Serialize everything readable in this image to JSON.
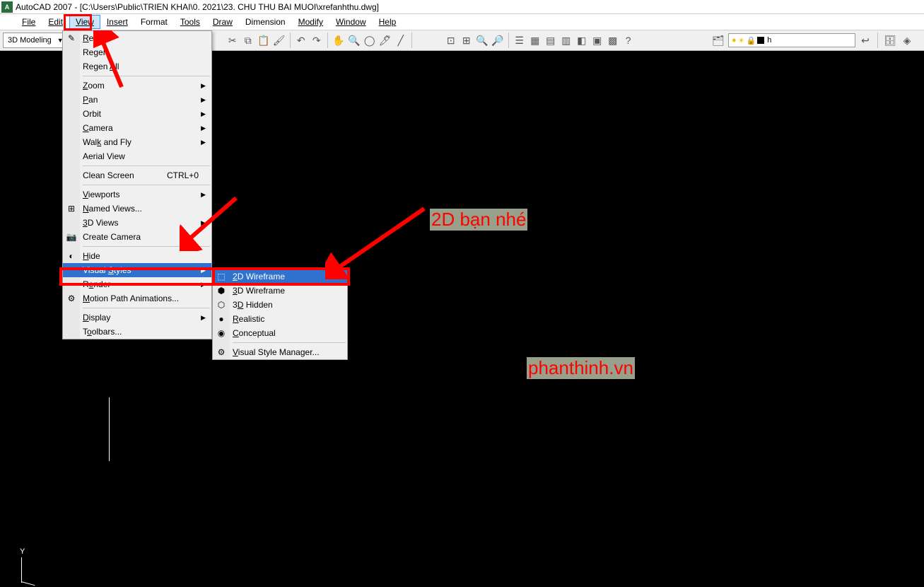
{
  "title": "AutoCAD 2007 - [C:\\Users\\Public\\TRIEN KHAI\\0. 2021\\23. CHU THU BAI MUOI\\xrefanhthu.dwg]",
  "menubar": {
    "file": "File",
    "edit": "Edit",
    "view": "View",
    "insert": "Insert",
    "format": "Format",
    "tools": "Tools",
    "draw": "Draw",
    "dimension": "Dimension",
    "modify": "Modify",
    "window": "Window",
    "help": "Help"
  },
  "toolbar": {
    "mode": "3D Modeling",
    "layer_text": "h"
  },
  "view_menu": {
    "redraw": "Redraw",
    "regen": "Regen",
    "regen_all": "Regen All",
    "zoom": "Zoom",
    "pan": "Pan",
    "orbit": "Orbit",
    "camera": "Camera",
    "walk_fly": "Walk and Fly",
    "aerial": "Aerial View",
    "clean": "Clean Screen",
    "clean_key": "CTRL+0",
    "viewports": "Viewports",
    "named_views": "Named Views...",
    "views3d": "3D Views",
    "create_camera": "Create Camera",
    "hide": "Hide",
    "visual_styles": "Visual Styles",
    "render": "Render",
    "motion_path": "Motion Path Animations...",
    "display": "Display",
    "toolbars": "Toolbars..."
  },
  "vs_submenu": {
    "wf2d": "2D Wireframe",
    "wf3d": "3D Wireframe",
    "hidden3d": "3D Hidden",
    "realistic": "Realistic",
    "conceptual": "Conceptual",
    "manager": "Visual Style Manager..."
  },
  "annot": {
    "a1": "2D bạn nhé",
    "a2": "phanthinh.vn"
  },
  "ucs": {
    "y": "Y"
  }
}
